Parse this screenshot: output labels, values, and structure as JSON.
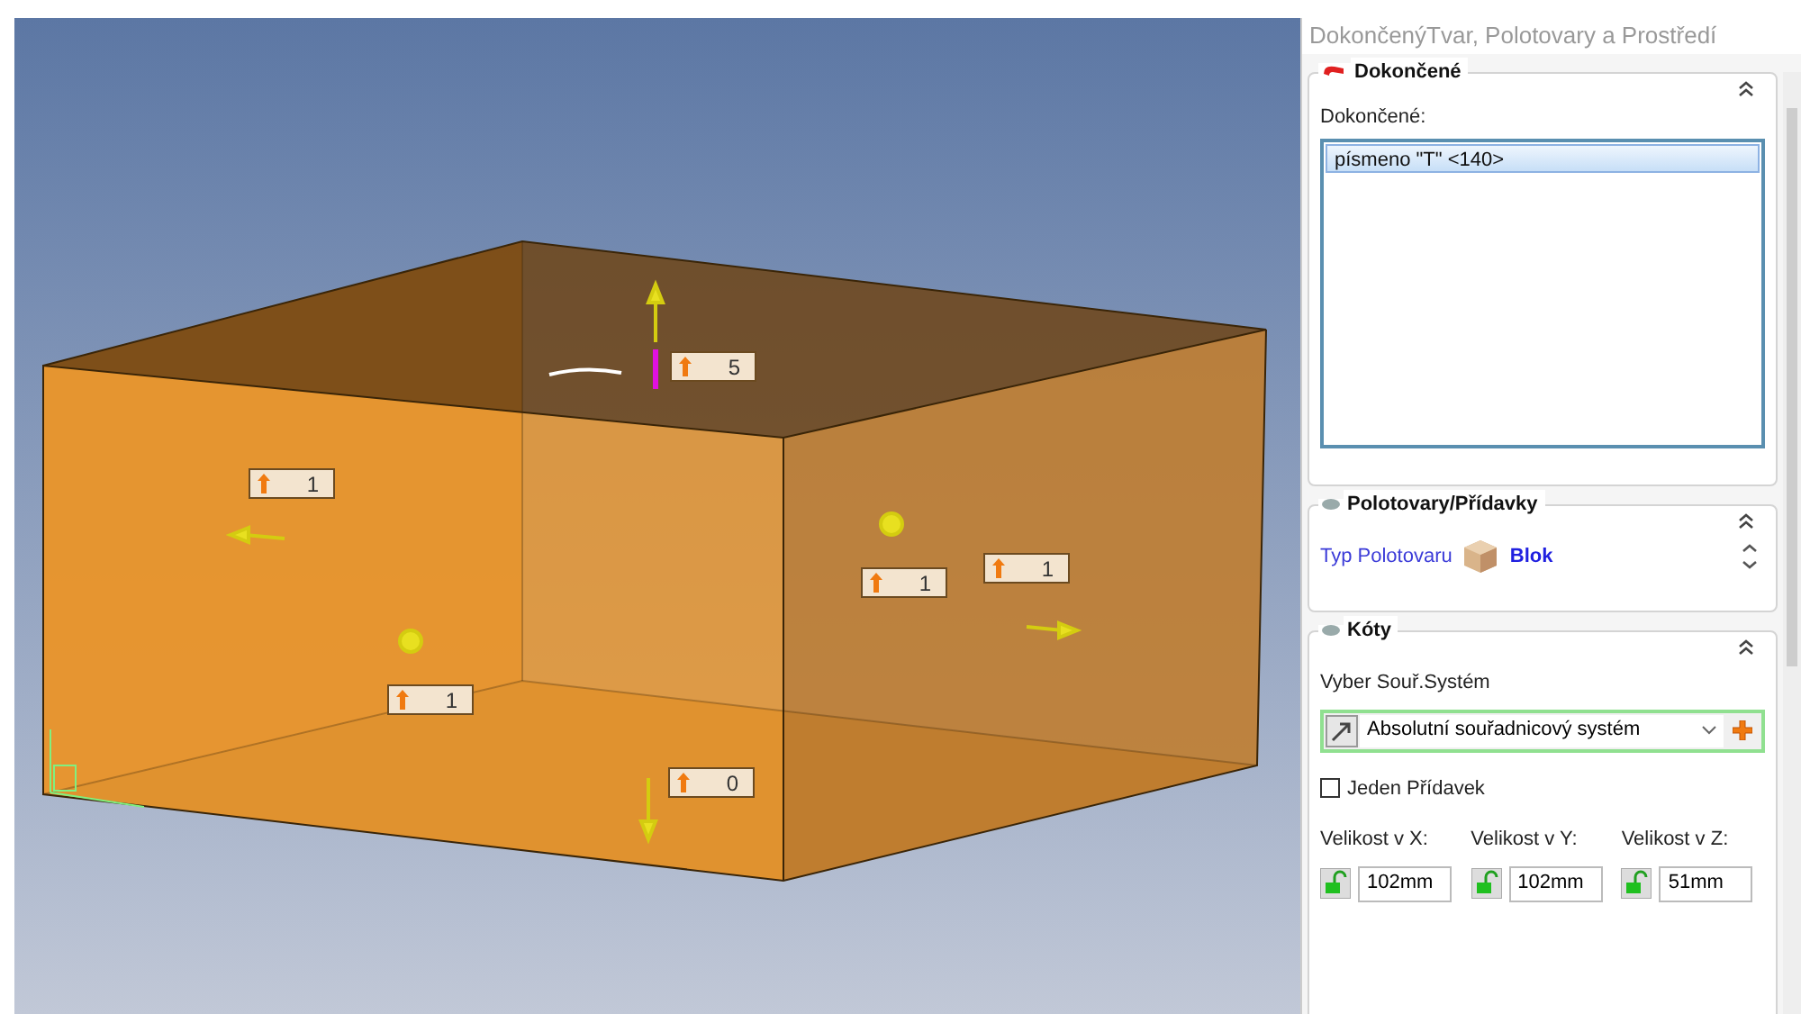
{
  "viewport": {
    "allowances": [
      {
        "value": "5"
      },
      {
        "value": "1"
      },
      {
        "value": "1"
      },
      {
        "value": "1"
      },
      {
        "value": "1"
      },
      {
        "value": "0"
      }
    ]
  },
  "panel": {
    "title": "DokončenýTvar, Polotovary a Prostředí",
    "finished": {
      "title": "Dokončené",
      "list_label": "Dokončené:",
      "items": [
        {
          "text": "písmeno \"T\" <140>",
          "selected": true
        }
      ]
    },
    "stock": {
      "title": "Polotovary/Přídavky",
      "type_label": "Typ Polotovaru",
      "type_value": "Blok"
    },
    "dimensions": {
      "title": "Kóty",
      "cs_label": "Vyber Souř.Systém",
      "cs_value": "Absolutní souřadnicový systém",
      "single": {
        "label": "Jeden Přídavek",
        "checked": false
      },
      "sizes": [
        {
          "label": "Velikost v X:",
          "value": "102mm"
        },
        {
          "label": "Velikost v Y:",
          "value": "102mm"
        },
        {
          "label": "Velikost v Z:",
          "value": "51mm"
        }
      ]
    }
  }
}
